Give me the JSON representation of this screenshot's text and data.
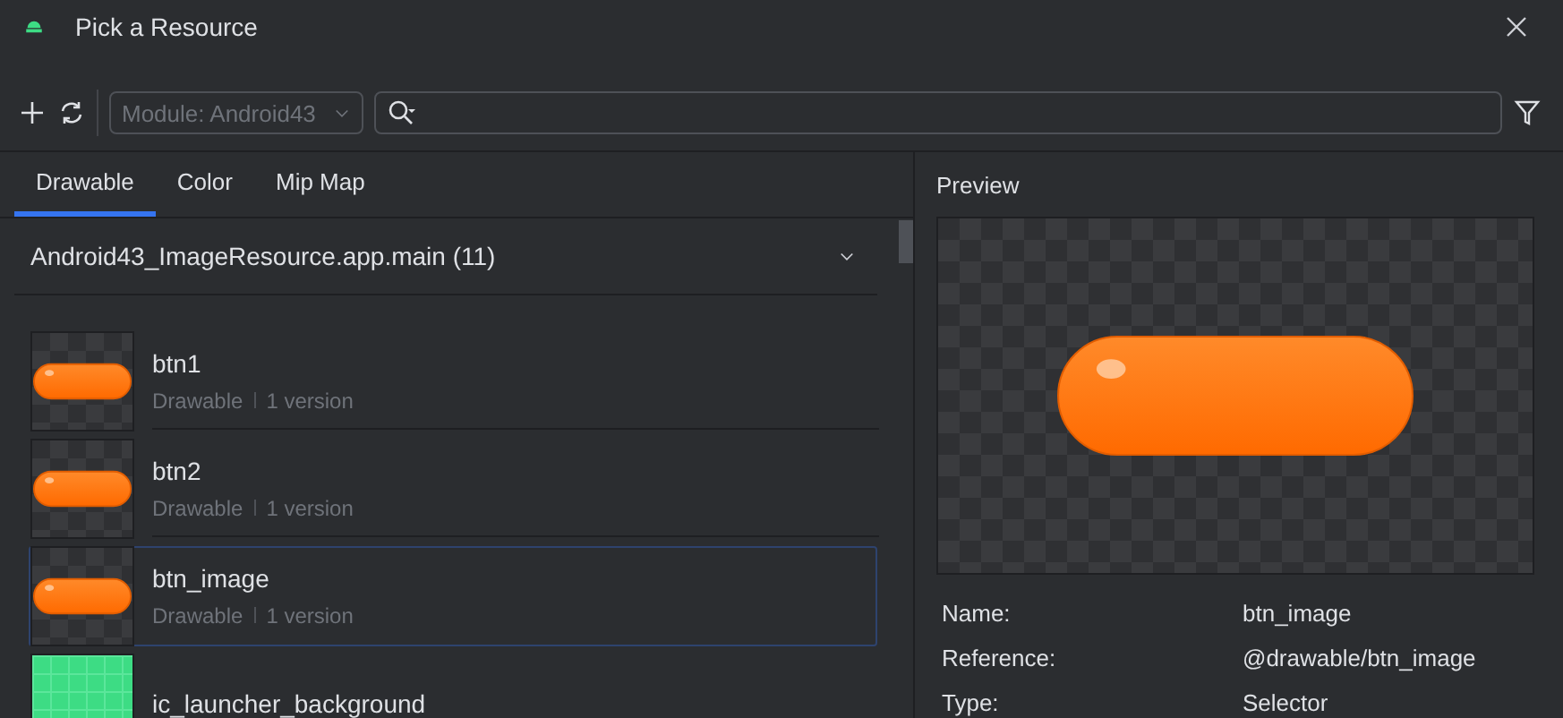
{
  "window": {
    "title": "Pick a Resource"
  },
  "toolbar": {
    "module": "Module: Android43"
  },
  "tabs": [
    {
      "label": "Drawable",
      "selected": true
    },
    {
      "label": "Color",
      "selected": false
    },
    {
      "label": "Mip Map",
      "selected": false
    }
  ],
  "group": {
    "title": "Android43_ImageResource.app.main (11)",
    "expanded": true
  },
  "resources": [
    {
      "name": "btn1",
      "type": "Drawable",
      "versions": "1 version",
      "kind": "pill",
      "selected": false
    },
    {
      "name": "btn2",
      "type": "Drawable",
      "versions": "1 version",
      "kind": "pill",
      "selected": false
    },
    {
      "name": "btn_image",
      "type": "Drawable",
      "versions": "1 version",
      "kind": "pill",
      "selected": true
    },
    {
      "name": "ic_launcher_background",
      "kind": "grid",
      "selected": false
    }
  ],
  "preview": {
    "title": "Preview",
    "properties": [
      {
        "label": "Name:",
        "value": "btn_image"
      },
      {
        "label": "Reference:",
        "value": "@drawable/btn_image"
      },
      {
        "label": "Type:",
        "value": "Selector"
      }
    ]
  }
}
